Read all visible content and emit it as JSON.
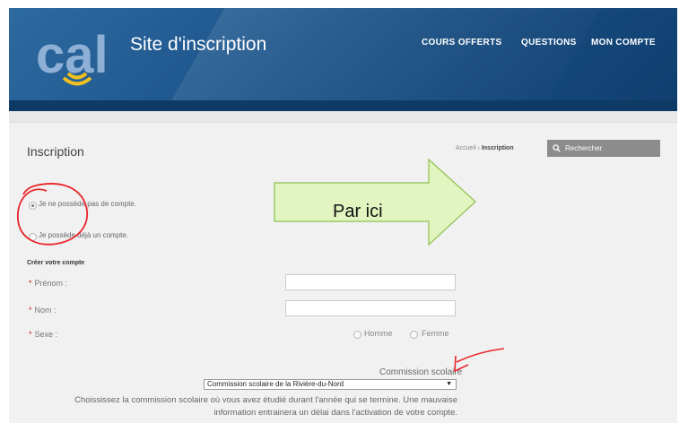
{
  "header": {
    "logo_text": "cal",
    "site_title": "Site d'inscription",
    "nav": [
      {
        "label": "COURS OFFERTS"
      },
      {
        "label": "QUESTIONS"
      },
      {
        "label": "MON COMPTE"
      }
    ]
  },
  "page": {
    "title": "Inscription",
    "breadcrumb": {
      "home": "Accueil",
      "separator": "›",
      "current": "Inscription"
    },
    "search_placeholder": "Rechercher"
  },
  "account_options": [
    {
      "label": "Je ne possède pas de compte.",
      "checked": true
    },
    {
      "label": "Je possède déjà un compte.",
      "checked": false
    }
  ],
  "form": {
    "section_title": "Créer votre compte",
    "required_marker": "*",
    "fields": [
      {
        "label": "Prénom :",
        "value": ""
      },
      {
        "label": "Nom :",
        "value": ""
      }
    ],
    "sexe_label": "Sexe :",
    "gender_options": [
      "Homme",
      "Femme"
    ],
    "commission_label": "Commission scolaire",
    "commission_selected": "Commission scolaire de la Rivière-du-Nord",
    "help_text": "Choississez la commission scolaire où vous avez étudié durant l'année qui se termine. Une mauvaise information entrainera un délai dans l'activation de votre compte."
  },
  "annotation": {
    "callout_text": "Par ici",
    "callout_color": "#e2f4bf",
    "ink_color": "#e8262c"
  },
  "colors": {
    "header_blue": "#1b5288",
    "accent_yellow": "#f0c020",
    "search_gray": "#8c8c8c"
  }
}
